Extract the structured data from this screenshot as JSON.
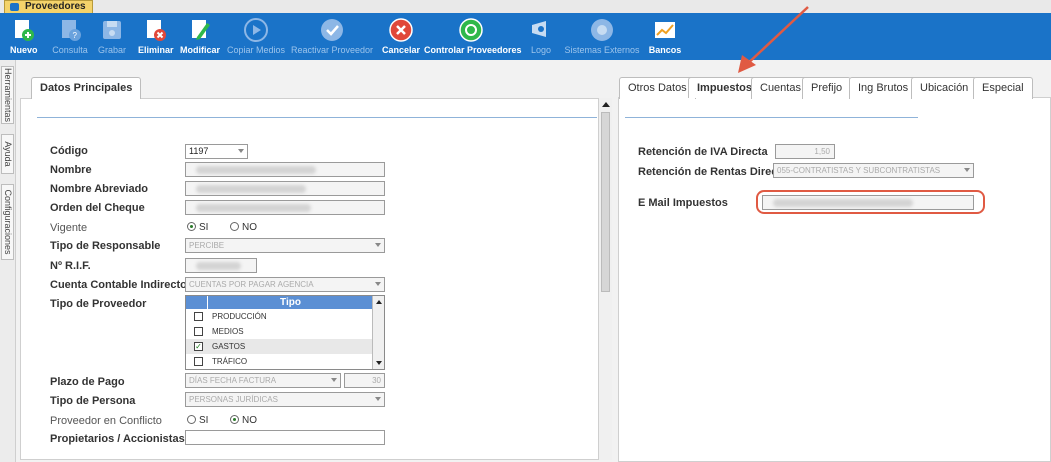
{
  "window": {
    "tab_title": "Proveedores"
  },
  "toolbar": {
    "nuevo": "Nuevo",
    "consulta": "Consulta",
    "grabar": "Grabar",
    "eliminar": "Eliminar",
    "modificar": "Modificar",
    "copiar_medios": "Copiar Medios",
    "reactivar": "Reactivar Proveedor",
    "cancelar": "Cancelar",
    "controlar": "Controlar Proveedores",
    "logo": "Logo",
    "sistemas_externos": "Sistemas Externos",
    "bancos": "Bancos"
  },
  "sidebar": {
    "herramientas": "Herramientas",
    "ayuda": "Ayuda",
    "configuraciones": "Configuraciones"
  },
  "left_panel": {
    "tab": "Datos Principales",
    "labels": {
      "codigo": "Código",
      "nombre": "Nombre",
      "nombre_abreviado": "Nombre Abreviado",
      "orden_cheque": "Orden del Cheque",
      "vigente": "Vigente",
      "tipo_responsable": "Tipo de Responsable",
      "rif": "Nº R.I.F.",
      "cuenta_contable": "Cuenta Contable Indirecto",
      "tipo_proveedor": "Tipo de Proveedor",
      "plazo_pago": "Plazo de Pago",
      "tipo_persona": "Tipo de Persona",
      "conflicto": "Proveedor en Conflicto",
      "propietarios": "Propietarios / Accionistas"
    },
    "values": {
      "codigo": "1197",
      "tipo_responsable": "PERCIBE",
      "cuenta_contable": "CUENTAS POR PAGAR AGENCIA",
      "plazo_pago": "DÍAS FECHA FACTURA",
      "plazo_dias": "30",
      "tipo_persona": "PERSONAS JURÍDICAS"
    },
    "radio": {
      "si": "SI",
      "no": "NO"
    },
    "tipo_list": {
      "header": "Tipo",
      "items": [
        {
          "label": "PRODUCCIÓN",
          "checked": false
        },
        {
          "label": "MEDIOS",
          "checked": false
        },
        {
          "label": "GASTOS",
          "checked": true
        },
        {
          "label": "TRÁFICO",
          "checked": false
        }
      ]
    }
  },
  "right_panel": {
    "tabs": [
      "Otros Datos",
      "Impuestos",
      "Cuentas",
      "Prefijo",
      "Ing Brutos",
      "Ubicación",
      "Especial"
    ],
    "active_tab": "Impuestos",
    "labels": {
      "ret_iva": "Retención de IVA Directa",
      "ret_rentas": "Retención de Rentas Directa",
      "email": "E Mail Impuestos"
    },
    "values": {
      "ret_iva": "1,50",
      "ret_rentas": "055-CONTRATISTAS Y SUBCONTRATISTAS"
    }
  },
  "colors": {
    "toolbar": "#1a73c8",
    "annotation": "#e05a43"
  }
}
